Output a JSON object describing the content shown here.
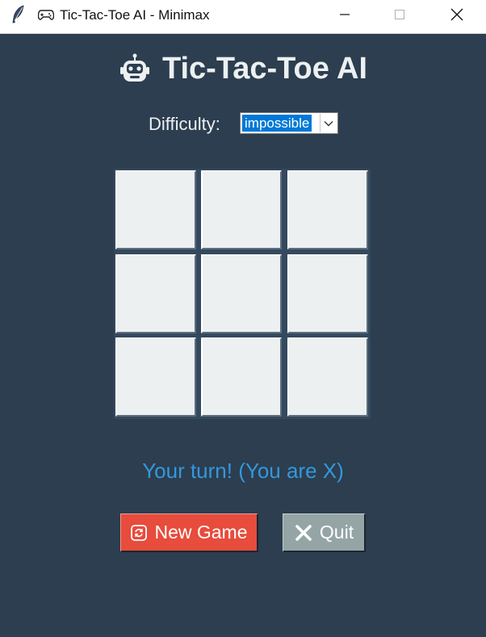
{
  "window": {
    "title": "Tic-Tac-Toe AI - Minimax",
    "title_icon": "gamepad-icon",
    "app_icon": "feather-icon"
  },
  "header": {
    "title": "Tic-Tac-Toe AI",
    "icon": "robot-icon"
  },
  "difficulty": {
    "label": "Difficulty:",
    "selected": "impossible"
  },
  "board": {
    "cells": [
      "",
      "",
      "",
      "",
      "",
      "",
      "",
      "",
      ""
    ]
  },
  "status": {
    "text": "Your turn! (You are X)",
    "color": "#3498db"
  },
  "buttons": {
    "new_game": {
      "label": "New Game",
      "icon": "refresh-icon",
      "color": "#e74c3c"
    },
    "quit": {
      "label": "Quit",
      "icon": "close-x-icon",
      "color": "#95a5a6"
    }
  },
  "colors": {
    "background": "#2c3e50",
    "cell": "#ecf0f1",
    "title_text": "#ecf0f1"
  }
}
